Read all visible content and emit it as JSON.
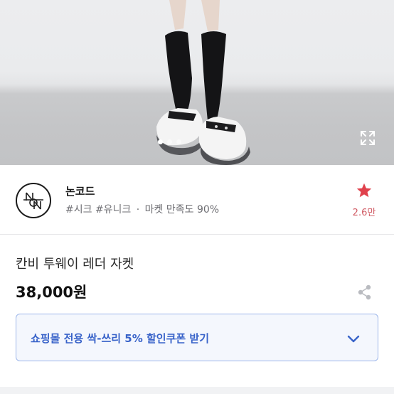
{
  "gallery": {
    "image_alt": "product-photo-model-in-black-socks-and-white-chunky-sneakers",
    "total_images": 3,
    "active_index": 0,
    "expand_icon": "expand-icon"
  },
  "shop": {
    "name": "논코드",
    "tags": "#시크 #유니크",
    "separator": "·",
    "satisfaction": "마켓 만족도 90%",
    "favorite_count": "2.6만",
    "favorite_icon": "star-icon",
    "favorite_color": "#e0414c"
  },
  "product": {
    "title": "칸비 투웨이 레더 자켓",
    "price": "38,000원",
    "share_icon": "share-icon"
  },
  "coupon": {
    "label": "쇼핑몰 전용 싹-쓰리 5% 할인쿠폰 받기",
    "icon": "chevron-down-icon",
    "accent": "#3863c9"
  }
}
